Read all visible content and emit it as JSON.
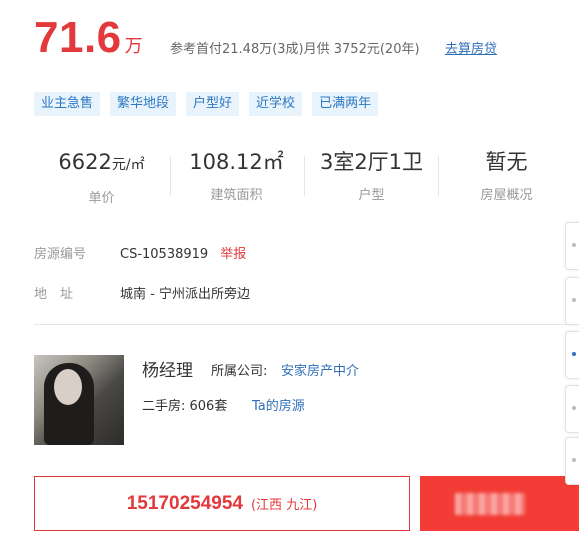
{
  "price": {
    "value": "71.6",
    "unit": "万"
  },
  "reference_text": "参考首付21.48万(3成)月供 3752元(20年)",
  "calc_link": "去算房贷",
  "tags": [
    "业主急售",
    "繁华地段",
    "户型好",
    "近学校",
    "已满两年"
  ],
  "stats": [
    {
      "value": "6622",
      "unit": "元/㎡",
      "label": "单价"
    },
    {
      "value": "108.12㎡",
      "unit": "",
      "label": "建筑面积"
    },
    {
      "value": "3室2厅1卫",
      "unit": "",
      "label": "户型"
    },
    {
      "value": "暂无",
      "unit": "",
      "label": "房屋概况"
    }
  ],
  "listing_no": {
    "label": "房源编号",
    "value": "CS-10538919",
    "report": "举报"
  },
  "address": {
    "label": "地　址",
    "value": "城南 - 宁州派出所旁边"
  },
  "agent": {
    "name": "杨经理",
    "company_label": "所属公司:",
    "company": "安家房产中介",
    "second_hand_label": "二手房: 606套",
    "listings_link": "Ta的房源"
  },
  "contact": {
    "phone": "15170254954",
    "region": "(江西 九江)"
  },
  "colors": {
    "accent": "#e4393c",
    "link": "#2f6fba",
    "tag_bg": "#e9f3fc",
    "button": "#f23c35"
  }
}
